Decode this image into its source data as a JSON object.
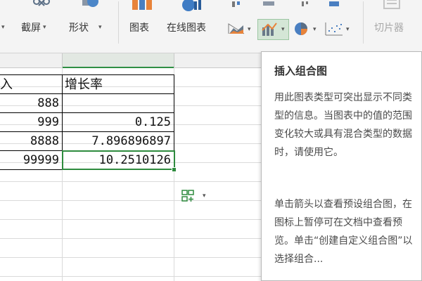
{
  "ribbon": {
    "screenshot_label": "截屏",
    "shapes_label": "形状",
    "chart_label": "图表",
    "online_chart_label": "在线图表",
    "slicer_label": "切片器",
    "caret": "▾"
  },
  "sheet": {
    "table_header": [
      "入",
      "增长率"
    ],
    "rows": [
      [
        "888",
        ""
      ],
      [
        "999",
        "0.125"
      ],
      [
        "8888",
        "7.896896897"
      ],
      [
        "99999",
        "10.2510126"
      ]
    ]
  },
  "paste_options": {
    "caret": "▾"
  },
  "tooltip": {
    "title": "插入组合图",
    "paragraph1": "用此图表类型可突出显示不同类型的信息。当图表中的值的范围变化较大或具有混合类型的数据时，请使用它。",
    "paragraph2": "单击箭头以查看预设组合图，在图标上暂停可在文档中查看预览。单击“创建自定义组合图”以选择组合..."
  },
  "colors": {
    "accent_green": "#2e8b3e",
    "bar_orange": "#e8833a",
    "bar_blue": "#4a7fc1"
  },
  "icons": [
    "screenshot-icon",
    "shapes-icon",
    "chart-icon",
    "online-chart-icon",
    "area-chart-icon",
    "combo-chart-icon",
    "pie-chart-icon",
    "scatter-chart-icon",
    "slicer-icon",
    "paste-options-icon"
  ]
}
